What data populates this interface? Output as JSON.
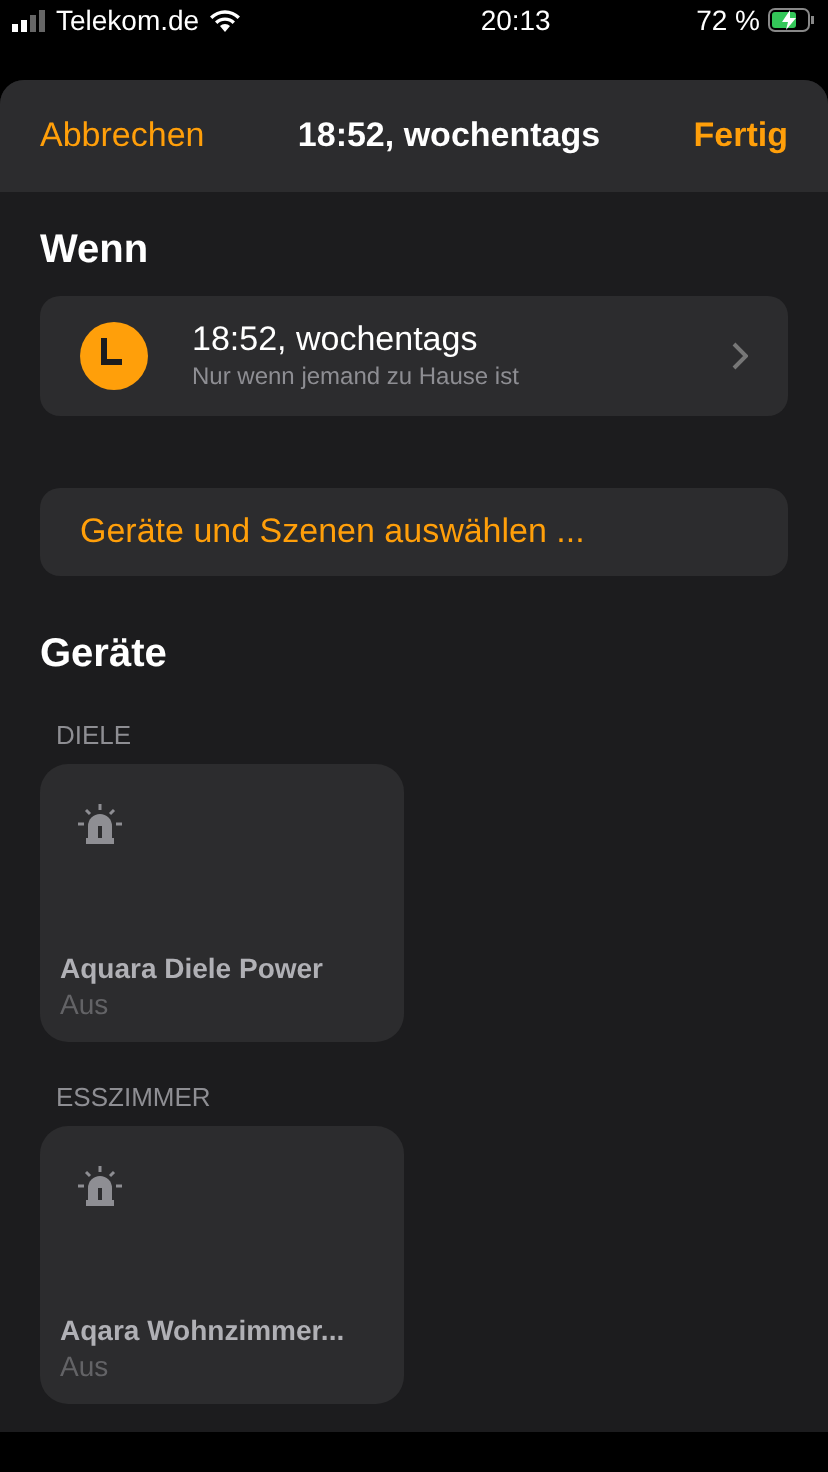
{
  "status_bar": {
    "carrier": "Telekom.de",
    "time": "20:13",
    "battery": "72 %"
  },
  "header": {
    "cancel": "Abbrechen",
    "title": "18:52, wochentags",
    "done": "Fertig"
  },
  "when": {
    "heading": "Wenn",
    "trigger": {
      "title": "18:52, wochentags",
      "subtitle": "Nur wenn jemand zu Hause ist"
    }
  },
  "select_button": "Geräte und Szenen auswählen ...",
  "devices": {
    "heading": "Geräte",
    "rooms": [
      {
        "name": "DIELE",
        "accessories": [
          {
            "name": "Aquara Diele Power",
            "state": "Aus"
          }
        ]
      },
      {
        "name": "ESSZIMMER",
        "accessories": [
          {
            "name": "Aqara Wohnzimmer...",
            "state": "Aus"
          }
        ]
      }
    ]
  }
}
